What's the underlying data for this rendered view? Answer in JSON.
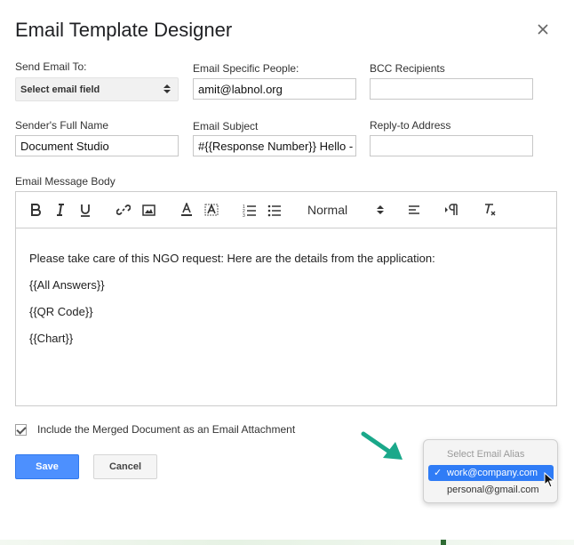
{
  "dialog": {
    "title": "Email Template Designer"
  },
  "fields": {
    "send_to": {
      "label": "Send Email To:",
      "value": "Select email field"
    },
    "specific_people": {
      "label": "Email Specific People:",
      "value": "amit@labnol.org"
    },
    "bcc": {
      "label": "BCC Recipients",
      "value": ""
    },
    "sender_name": {
      "label": "Sender's Full Name",
      "value": "Document Studio"
    },
    "subject": {
      "label": "Email Subject",
      "value": "#{{Response Number}}  Hello -"
    },
    "reply_to": {
      "label": "Reply-to Address",
      "value": ""
    }
  },
  "editor": {
    "label": "Email Message Body",
    "heading_select": "Normal",
    "body_lines": [
      "Please take care of this NGO request: Here are the details from the application:",
      "{{All Answers}}",
      "{{QR Code}}",
      "{{Chart}}"
    ]
  },
  "attachment": {
    "label": "Include the Merged Document as an Email Attachment",
    "checked": true
  },
  "buttons": {
    "save": "Save",
    "cancel": "Cancel"
  },
  "alias_dropdown": {
    "header": "Select Email Alias",
    "options": [
      "work@company.com",
      "personal@gmail.com"
    ],
    "selected": "work@company.com",
    "check_glyph": "✓"
  },
  "colors": {
    "primary_button": "#4d90fe",
    "selected_option": "#2f7cf6",
    "arrow": "#1aa88a"
  },
  "icons": [
    "close-icon",
    "bold-icon",
    "italic-icon",
    "underline-icon",
    "link-icon",
    "image-icon",
    "text-color-icon",
    "background-color-icon",
    "ordered-list-icon",
    "bullet-list-icon",
    "align-icon",
    "text-direction-icon",
    "clear-format-icon",
    "checkmark-icon",
    "mouse-cursor-icon"
  ]
}
